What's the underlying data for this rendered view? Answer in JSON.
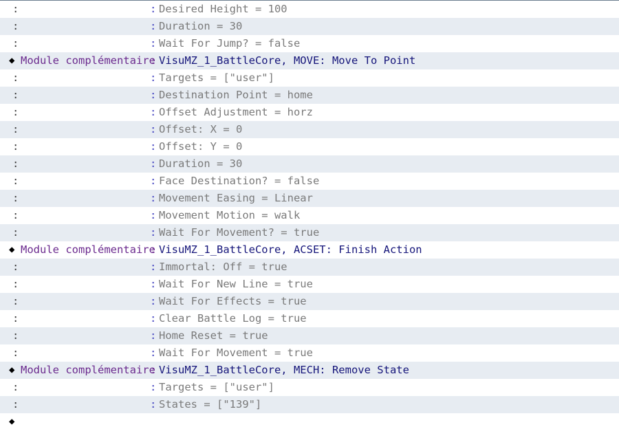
{
  "rows": [
    {
      "kind": "param",
      "lead": ":",
      "sep": ":",
      "text": "Desired Height = 100"
    },
    {
      "kind": "param",
      "lead": ":",
      "sep": ":",
      "text": "Duration = 30"
    },
    {
      "kind": "param",
      "lead": ":",
      "sep": ":",
      "text": "Wait For Jump? = false"
    },
    {
      "kind": "cmd",
      "diamond": "◆",
      "label": "Module complémentaire",
      "sep": ":",
      "text": "VisuMZ_1_BattleCore, MOVE: Move To Point"
    },
    {
      "kind": "param",
      "lead": ":",
      "sep": ":",
      "text": "Targets = [\"user\"]"
    },
    {
      "kind": "param",
      "lead": ":",
      "sep": ":",
      "text": "Destination Point = home"
    },
    {
      "kind": "param",
      "lead": ":",
      "sep": ":",
      "text": "Offset Adjustment = horz"
    },
    {
      "kind": "param",
      "lead": ":",
      "sep": ":",
      "text": "Offset: X = 0"
    },
    {
      "kind": "param",
      "lead": ":",
      "sep": ":",
      "text": "Offset: Y = 0"
    },
    {
      "kind": "param",
      "lead": ":",
      "sep": ":",
      "text": "Duration = 30"
    },
    {
      "kind": "param",
      "lead": ":",
      "sep": ":",
      "text": "Face Destination? = false"
    },
    {
      "kind": "param",
      "lead": ":",
      "sep": ":",
      "text": "Movement Easing = Linear"
    },
    {
      "kind": "param",
      "lead": ":",
      "sep": ":",
      "text": "Movement Motion = walk"
    },
    {
      "kind": "param",
      "lead": ":",
      "sep": ":",
      "text": "Wait For Movement? = true"
    },
    {
      "kind": "cmd",
      "diamond": "◆",
      "label": "Module complémentaire",
      "sep": ":",
      "text": "VisuMZ_1_BattleCore, ACSET: Finish Action"
    },
    {
      "kind": "param",
      "lead": ":",
      "sep": ":",
      "text": "Immortal: Off = true"
    },
    {
      "kind": "param",
      "lead": ":",
      "sep": ":",
      "text": "Wait For New Line = true"
    },
    {
      "kind": "param",
      "lead": ":",
      "sep": ":",
      "text": "Wait For Effects = true"
    },
    {
      "kind": "param",
      "lead": ":",
      "sep": ":",
      "text": "Clear Battle Log = true"
    },
    {
      "kind": "param",
      "lead": ":",
      "sep": ":",
      "text": "Home Reset = true"
    },
    {
      "kind": "param",
      "lead": ":",
      "sep": ":",
      "text": "Wait For Movement = true"
    },
    {
      "kind": "cmd",
      "diamond": "◆",
      "label": "Module complémentaire",
      "sep": ":",
      "text": "VisuMZ_1_BattleCore, MECH: Remove State"
    },
    {
      "kind": "param",
      "lead": ":",
      "sep": ":",
      "text": "Targets = [\"user\"]"
    },
    {
      "kind": "param",
      "lead": ":",
      "sep": ":",
      "text": "States = [\"139\"]"
    },
    {
      "kind": "end",
      "diamond": "◆"
    }
  ]
}
